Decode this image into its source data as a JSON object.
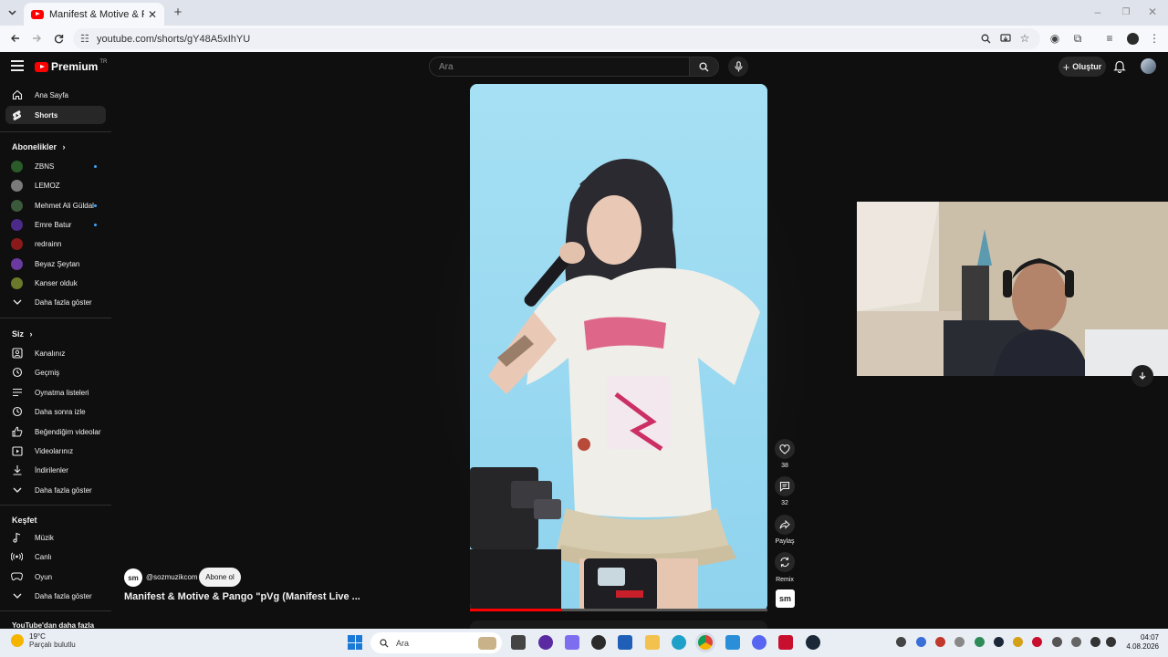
{
  "browser": {
    "tab_title": "Manifest & Motive & Pango \"pVg",
    "url": "youtube.com/shorts/gY48A5xIhYU"
  },
  "header": {
    "logo_text": "Premium",
    "logo_badge": "TR",
    "search_placeholder": "Ara",
    "create_label": "Oluştur"
  },
  "sidebar": {
    "main": [
      {
        "label": "Ana Sayfa",
        "icon": "home-icon"
      },
      {
        "label": "Shorts",
        "icon": "shorts-icon",
        "active": true
      }
    ],
    "subscriptions_title": "Abonelikler",
    "subscriptions": [
      {
        "label": "ZBNS",
        "color": "#2a5b2a",
        "new": true
      },
      {
        "label": "LEMOZ",
        "color": "#7a7a7a",
        "new": false
      },
      {
        "label": "Mehmet Ali Güldal",
        "color": "#3b5a3b",
        "new": true
      },
      {
        "label": "Emre Batur",
        "color": "#4b2a8a",
        "new": true
      },
      {
        "label": "redrainn",
        "color": "#8a1a1a",
        "new": false
      },
      {
        "label": "Beyaz Şeytan",
        "color": "#6a3aa0",
        "new": false
      },
      {
        "label": "Kanser olduk",
        "color": "#6a7a2a",
        "new": false
      }
    ],
    "show_more": "Daha fazla göster",
    "you_title": "Siz",
    "you_items": [
      {
        "label": "Kanalınız",
        "icon": "channel-icon"
      },
      {
        "label": "Geçmiş",
        "icon": "history-icon"
      },
      {
        "label": "Oynatma listeleri",
        "icon": "playlist-icon"
      },
      {
        "label": "Daha sonra izle",
        "icon": "clock-icon"
      },
      {
        "label": "Beğendiğim videolar",
        "icon": "like-icon"
      },
      {
        "label": "Videolarınız",
        "icon": "video-icon"
      },
      {
        "label": "İndirilenler",
        "icon": "download-icon"
      },
      {
        "label": "Daha fazla göster",
        "icon": "chevron-down-icon"
      }
    ],
    "explore_title": "Keşfet",
    "explore_items": [
      {
        "label": "Müzik",
        "icon": "music-icon"
      },
      {
        "label": "Canlı",
        "icon": "live-icon"
      },
      {
        "label": "Oyun",
        "icon": "gaming-icon"
      },
      {
        "label": "Daha fazla göster",
        "icon": "chevron-down-icon"
      }
    ],
    "more_from_youtube": "YouTube'dan daha fazla"
  },
  "video": {
    "channel_handle": "@sozmuzikcom",
    "channel_avatar_text": "sm",
    "subscribe_label": "Abone ol",
    "title": "Manifest & Motive & Pango \"pVg (Manifest Live ...",
    "progress": 0.31,
    "actions": {
      "like_count": "38",
      "comment_count": "32",
      "share_label": "Paylaş",
      "remix_label": "Remix"
    },
    "sound_logo_text": "sm"
  },
  "taskbar": {
    "temperature": "19°C",
    "weather_desc": "Parçalı bulutlu",
    "search_placeholder": "Ara",
    "time": "04:07",
    "date": "4.08.2026"
  },
  "colors": {
    "accent_red": "#ff0000",
    "background": "#0f0f0f",
    "video_sky": "#9fdcf2"
  }
}
